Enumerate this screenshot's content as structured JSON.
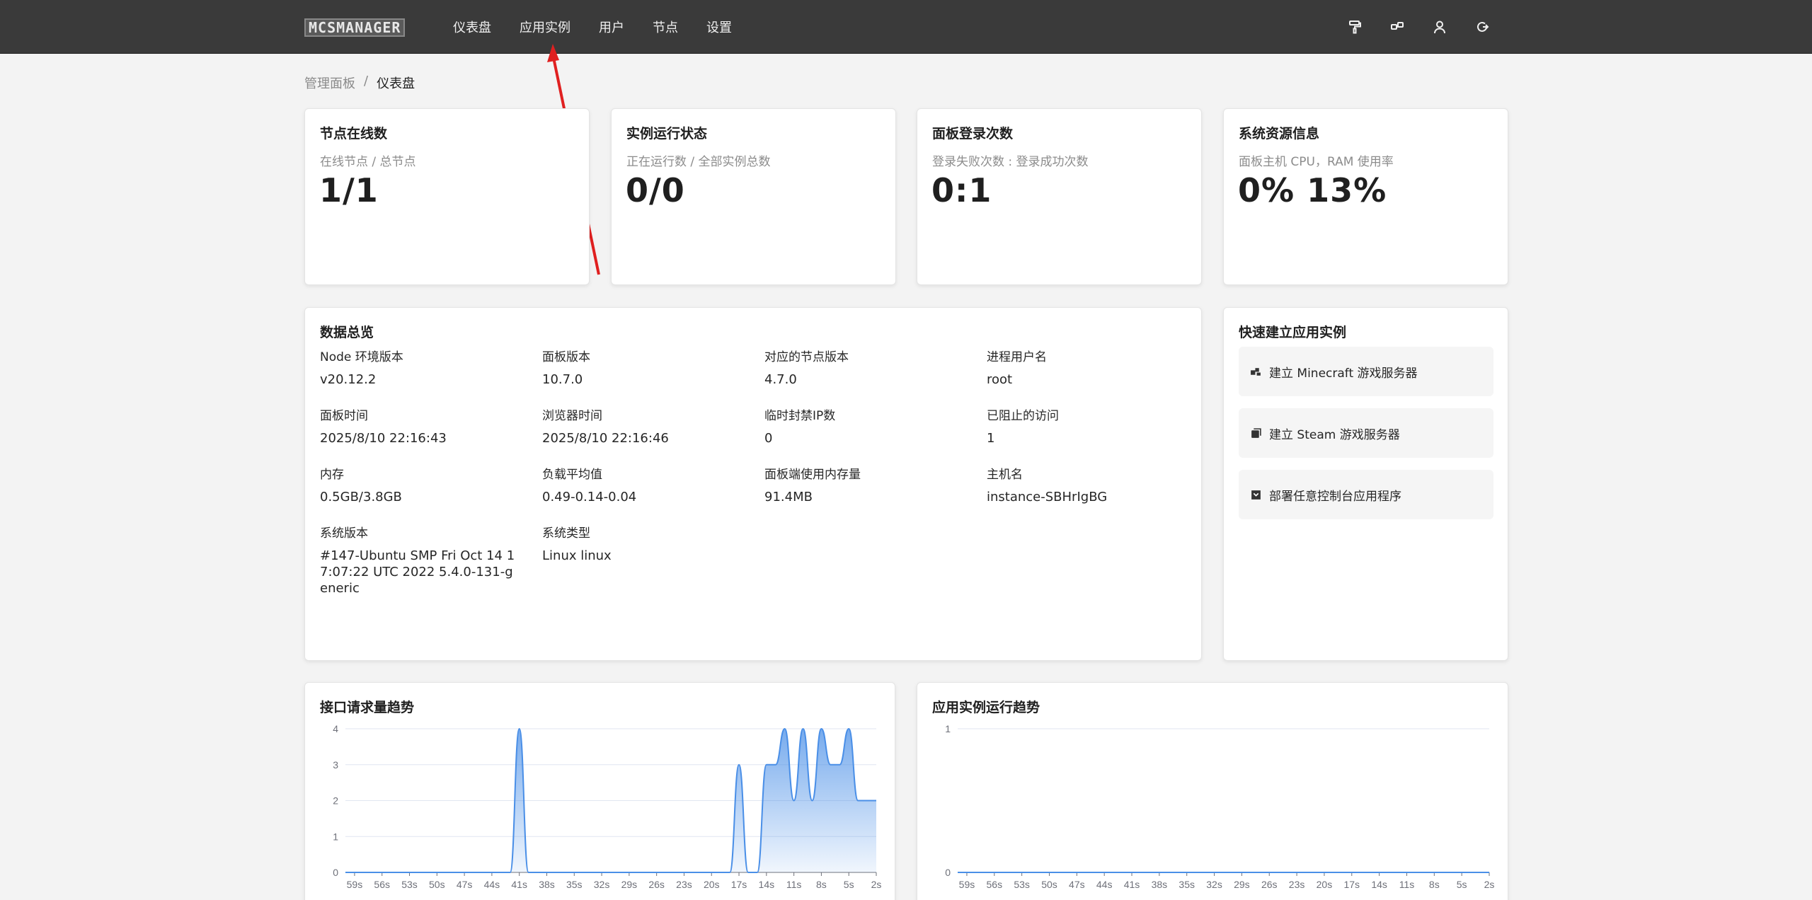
{
  "nav": {
    "logo": "MCSMANAGER",
    "items": [
      "仪表盘",
      "应用实例",
      "用户",
      "节点",
      "设置"
    ]
  },
  "breadcrumb": {
    "parent": "管理面板",
    "separator": "/",
    "current": "仪表盘"
  },
  "stats": [
    {
      "title": "节点在线数",
      "sub": "在线节点 / 总节点",
      "value": "1/1"
    },
    {
      "title": "实例运行状态",
      "sub": "正在运行数 / 全部实例总数",
      "value": "0/0"
    },
    {
      "title": "面板登录次数",
      "sub": "登录失败次数 : 登录成功次数",
      "value": "0:1"
    },
    {
      "title": "系统资源信息",
      "sub": "面板主机 CPU，RAM 使用率",
      "value": "0% 13%"
    }
  ],
  "overview": {
    "title": "数据总览",
    "items": [
      {
        "label": "Node 环境版本",
        "value": "v20.12.2"
      },
      {
        "label": "面板版本",
        "value": "10.7.0"
      },
      {
        "label": "对应的节点版本",
        "value": "4.7.0"
      },
      {
        "label": "进程用户名",
        "value": "root"
      },
      {
        "label": "面板时间",
        "value": "2025/8/10 22:16:43"
      },
      {
        "label": "浏览器时间",
        "value": "2025/8/10 22:16:46"
      },
      {
        "label": "临时封禁IP数",
        "value": "0"
      },
      {
        "label": "已阻止的访问",
        "value": "1"
      },
      {
        "label": "内存",
        "value": "0.5GB/3.8GB"
      },
      {
        "label": "负载平均值",
        "value": "0.49-0.14-0.04"
      },
      {
        "label": "面板端使用内存量",
        "value": "91.4MB"
      },
      {
        "label": "主机名",
        "value": "instance-SBHrIgBG"
      },
      {
        "label": "系统版本",
        "value": "#147-Ubuntu SMP Fri Oct 14 17:07:22 UTC 2022 5.4.0-131-generic"
      },
      {
        "label": "系统类型",
        "value": "Linux linux"
      }
    ]
  },
  "quick": {
    "title": "快速建立应用实例",
    "buttons": [
      {
        "label": "建立 Minecraft 游戏服务器",
        "icon": "blocks-icon"
      },
      {
        "label": "建立 Steam 游戏服务器",
        "icon": "stack-icon"
      },
      {
        "label": "部署任意控制台应用程序",
        "icon": "terminal-icon"
      }
    ]
  },
  "chart_data": [
    {
      "type": "area",
      "title": "接口请求量趋势",
      "x": [
        "59s",
        "56s",
        "53s",
        "50s",
        "47s",
        "44s",
        "41s",
        "38s",
        "35s",
        "32s",
        "29s",
        "26s",
        "23s",
        "20s",
        "17s",
        "14s",
        "11s",
        "8s",
        "5s",
        "2s"
      ],
      "ylim": [
        0,
        4
      ],
      "yticks": [
        0,
        1,
        2,
        3,
        4
      ],
      "points": [
        [
          60,
          0
        ],
        [
          59,
          0
        ],
        [
          58,
          0
        ],
        [
          57,
          0
        ],
        [
          56,
          0
        ],
        [
          55,
          0
        ],
        [
          54,
          0
        ],
        [
          53,
          0
        ],
        [
          52,
          0
        ],
        [
          51,
          0
        ],
        [
          50,
          0
        ],
        [
          49,
          0
        ],
        [
          48,
          0
        ],
        [
          47,
          0
        ],
        [
          46,
          0
        ],
        [
          45,
          0
        ],
        [
          44,
          0
        ],
        [
          43,
          0
        ],
        [
          42,
          0
        ],
        [
          41,
          4
        ],
        [
          40,
          0
        ],
        [
          39,
          0
        ],
        [
          38,
          0
        ],
        [
          37,
          0
        ],
        [
          36,
          0
        ],
        [
          35,
          0
        ],
        [
          34,
          0
        ],
        [
          33,
          0
        ],
        [
          32,
          0
        ],
        [
          31,
          0
        ],
        [
          30,
          0
        ],
        [
          29,
          0
        ],
        [
          28,
          0
        ],
        [
          27,
          0
        ],
        [
          26,
          0
        ],
        [
          25,
          0
        ],
        [
          24,
          0
        ],
        [
          23,
          0
        ],
        [
          22,
          0
        ],
        [
          21,
          0
        ],
        [
          20,
          0
        ],
        [
          19,
          0
        ],
        [
          18,
          0
        ],
        [
          17,
          3
        ],
        [
          16,
          0
        ],
        [
          15,
          0
        ],
        [
          14,
          3
        ],
        [
          13,
          3
        ],
        [
          12,
          4
        ],
        [
          11,
          2
        ],
        [
          10,
          4
        ],
        [
          9,
          2
        ],
        [
          8,
          4
        ],
        [
          7,
          3
        ],
        [
          6,
          3
        ],
        [
          5,
          4
        ],
        [
          4,
          2
        ],
        [
          3,
          2
        ],
        [
          2,
          2
        ]
      ],
      "color": "#4a8fe7"
    },
    {
      "type": "line",
      "title": "应用实例运行趋势",
      "x": [
        "59s",
        "56s",
        "53s",
        "50s",
        "47s",
        "44s",
        "41s",
        "38s",
        "35s",
        "32s",
        "29s",
        "26s",
        "23s",
        "20s",
        "17s",
        "14s",
        "11s",
        "8s",
        "5s",
        "2s"
      ],
      "ylim": [
        0,
        1
      ],
      "yticks": [
        0,
        1
      ],
      "points": [
        [
          60,
          0
        ],
        [
          2,
          0
        ]
      ],
      "color": "#4a8fe7"
    }
  ]
}
